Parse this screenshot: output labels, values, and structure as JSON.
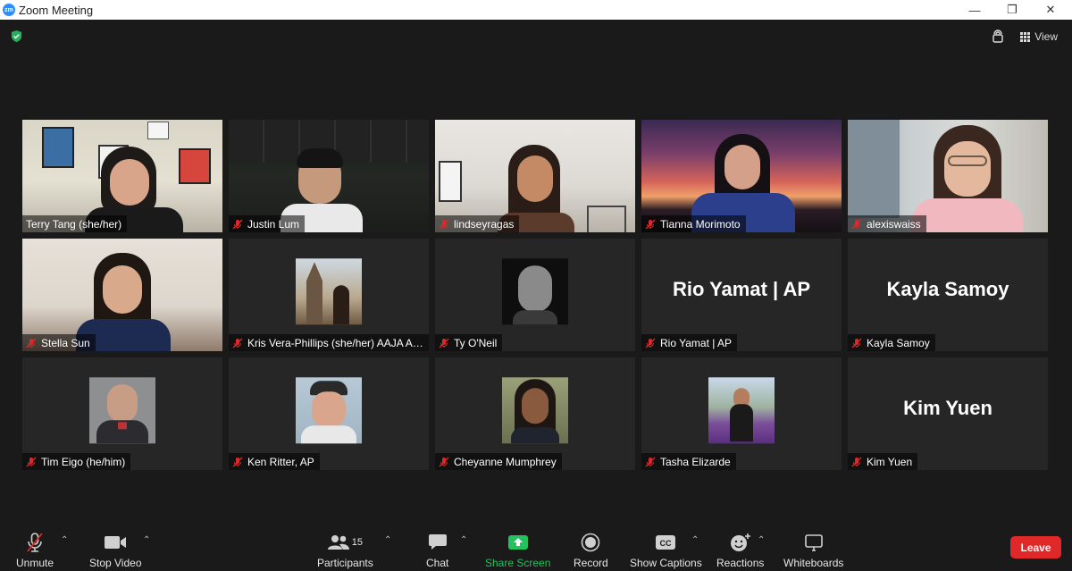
{
  "window": {
    "title": "Zoom Meeting",
    "logo": "zm"
  },
  "top_bar": {
    "view_label": "View"
  },
  "participants": [
    {
      "name": "Terry Tang (she/her)",
      "type": "video",
      "active_speaker": true,
      "muted": false
    },
    {
      "name": "Justin Lum",
      "type": "video",
      "muted": true
    },
    {
      "name": "lindseyragas",
      "type": "video",
      "muted": true
    },
    {
      "name": "Tianna Morimoto",
      "type": "video",
      "muted": true
    },
    {
      "name": "alexiswaiss",
      "type": "video",
      "muted": true
    },
    {
      "name": "Stella Sun",
      "type": "video",
      "muted": true
    },
    {
      "name": "Kris Vera-Phillips (she/her) AAJA Ariz...",
      "type": "avatar",
      "muted": true
    },
    {
      "name": "Ty O'Neil",
      "type": "avatar",
      "muted": true
    },
    {
      "name": "Rio Yamat | AP",
      "type": "text",
      "display_name": "Rio Yamat | AP",
      "muted": true
    },
    {
      "name": "Kayla Samoy",
      "type": "text",
      "display_name": "Kayla Samoy",
      "muted": true
    },
    {
      "name": "Tim Eigo (he/him)",
      "type": "avatar",
      "muted": true
    },
    {
      "name": "Ken Ritter, AP",
      "type": "avatar",
      "muted": true
    },
    {
      "name": "Cheyanne Mumphrey",
      "type": "avatar",
      "muted": true
    },
    {
      "name": "Tasha Elizarde",
      "type": "avatar",
      "muted": true
    },
    {
      "name": "Kim Yuen",
      "type": "text",
      "display_name": "Kim Yuen",
      "muted": true
    }
  ],
  "toolbar": {
    "unmute": "Unmute",
    "stop_video": "Stop Video",
    "participants": "Participants",
    "participants_count": "15",
    "chat": "Chat",
    "share_screen": "Share Screen",
    "record": "Record",
    "show_captions": "Show Captions",
    "captions_icon_text": "CC",
    "reactions": "Reactions",
    "whiteboards": "Whiteboards",
    "leave": "Leave"
  },
  "colors": {
    "active_border": "#d7e46a",
    "share_green": "#22c35e",
    "leave_red": "#e02828",
    "muted_red": "#e02828"
  }
}
